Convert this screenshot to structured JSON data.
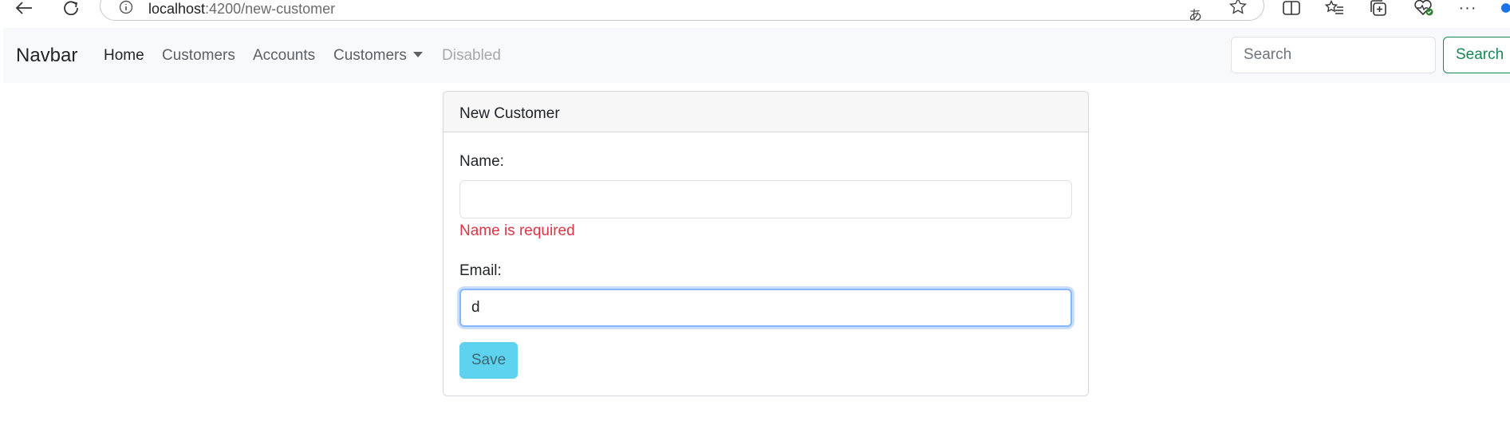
{
  "browser": {
    "url_host": "localhost",
    "url_path": ":4200/new-customer",
    "icons": [
      "back-icon",
      "reload-icon",
      "site-info-icon",
      "translate-icon",
      "favorite-star-icon",
      "split-screen-icon",
      "favorites-icon",
      "collections-icon",
      "browser-essentials-icon",
      "more-icon"
    ]
  },
  "navbar": {
    "brand": "Navbar",
    "links": [
      {
        "label": "Home",
        "state": "active"
      },
      {
        "label": "Customers",
        "state": "normal"
      },
      {
        "label": "Accounts",
        "state": "normal"
      },
      {
        "label": "Customers",
        "state": "dropdown"
      },
      {
        "label": "Disabled",
        "state": "disabled"
      }
    ],
    "search_placeholder": "Search",
    "search_button": "Search"
  },
  "form": {
    "title": "New Customer",
    "name_label": "Name:",
    "name_value": "",
    "name_error": "Name is required",
    "email_label": "Email:",
    "email_value": "d",
    "save_label": "Save"
  },
  "colors": {
    "navbar_bg": "#f8f9fa",
    "error": "#dc3545",
    "success": "#198754",
    "save_button": "#5ed3ef",
    "focus_ring": "#86b7fe"
  }
}
